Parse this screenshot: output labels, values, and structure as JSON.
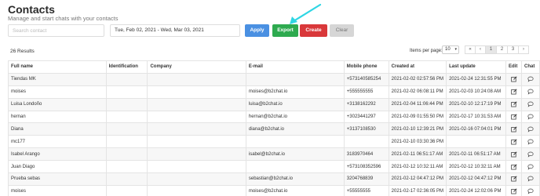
{
  "page": {
    "title": "Contacts",
    "subtitle": "Manage and start chats with your contacts"
  },
  "filters": {
    "search_placeholder": "Search contact",
    "date_range": "Tue, Feb 02, 2021 - Wed, Mar 03, 2021"
  },
  "buttons": {
    "apply": "Apply",
    "export": "Export",
    "create": "Create",
    "clear": "Clear"
  },
  "annotation": {
    "arrow_color": "#2fd6e4"
  },
  "results": {
    "count_label": "26 Results",
    "items_per_page_label": "Items per page:",
    "items_per_page_value": "10"
  },
  "pagination": {
    "first": "«",
    "prev": "‹",
    "pages": [
      "1",
      "2",
      "3"
    ],
    "next": "›",
    "current_page": "1"
  },
  "table": {
    "columns": [
      "Full name",
      "Identification",
      "Company",
      "E-mail",
      "Mobile phone",
      "Created at",
      "Last update",
      "Edit",
      "Chat"
    ],
    "rows": [
      {
        "full_name": "Tiendas MK",
        "identification": "",
        "company": "",
        "email": "",
        "mobile": "+573140585254",
        "created_at": "2021-02-02 02:57:56 PM",
        "last_update": "2021-02-24 12:31:55 PM"
      },
      {
        "full_name": "moises",
        "identification": "",
        "company": "",
        "email": "moises@b2chat.io",
        "mobile": "+555555555",
        "created_at": "2021-02-02 06:08:11 PM",
        "last_update": "2021-02-03 10:24:08 AM"
      },
      {
        "full_name": "Luisa Londoño",
        "identification": "",
        "company": "",
        "email": "luisa@b2chat.io",
        "mobile": "+3138162292",
        "created_at": "2021-02-04 11:06:44 PM",
        "last_update": "2021-02-10 12:17:19 PM"
      },
      {
        "full_name": "hernan",
        "identification": "",
        "company": "",
        "email": "hernan@b2chat.io",
        "mobile": "+3023441297",
        "created_at": "2021-02-09 01:55:50 PM",
        "last_update": "2021-02-17 10:31:53 AM"
      },
      {
        "full_name": "Diana",
        "identification": "",
        "company": "",
        "email": "diana@b2chat.io",
        "mobile": "+3137108530",
        "created_at": "2021-02-10 12:39:21 PM",
        "last_update": "2021-02-16 07:04:01 PM"
      },
      {
        "full_name": "mc177",
        "identification": "",
        "company": "",
        "email": "",
        "mobile": "",
        "created_at": "2021-02-10 03:30:36 PM",
        "last_update": ""
      },
      {
        "full_name": "Isabel Arango",
        "identification": "",
        "company": "",
        "email": "isabel@b2chat.io",
        "mobile": "3183970464",
        "created_at": "2021-02-11 06:51:17 AM",
        "last_update": "2021-02-11 06:51:17 AM"
      },
      {
        "full_name": "Juan Diago",
        "identification": "",
        "company": "",
        "email": "",
        "mobile": "+573108352596",
        "created_at": "2021-02-12 10:32:11 AM",
        "last_update": "2021-02-12 10:32:11 AM"
      },
      {
        "full_name": "Prueba sebas",
        "identification": "",
        "company": "",
        "email": "sebastian@b2chat.io",
        "mobile": "3204768839",
        "created_at": "2021-02-12 04:47:12 PM",
        "last_update": "2021-02-12 04:47:12 PM"
      },
      {
        "full_name": "moises",
        "identification": "",
        "company": "",
        "email": "moises@b2chat.io",
        "mobile": "+55555555",
        "created_at": "2021-02-17 02:36:05 PM",
        "last_update": "2021-02-24 12:02:06 PM"
      }
    ]
  }
}
